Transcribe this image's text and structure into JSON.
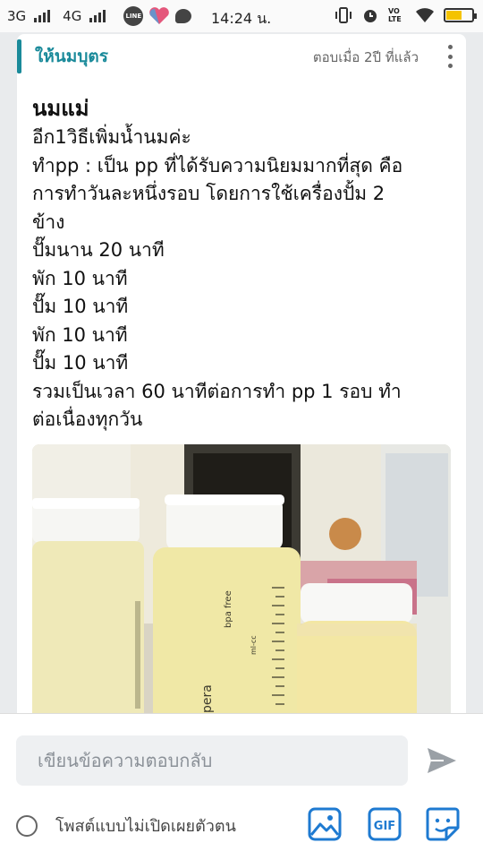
{
  "status_bar": {
    "network1": "3G",
    "network2": "4G",
    "line_label": "LINE",
    "time": "14:24 น.",
    "lte_label": "VO LTE"
  },
  "post": {
    "category": "ให้นมบุตร",
    "reply_time": "ตอบเมื่อ 2ปี ที่แล้ว",
    "title": "นมแม่",
    "body_lines": [
      "อีก1วิธีเพิ่มน้ำนมค่ะ",
      "ทำpp : เป็น pp ที่ได้รับความนิยมมากที่สุด คือ",
      "การทำวันละหนึ่งรอบ โดยการใช้เครื่องปั้ม 2",
      "ข้าง",
      "ปั๊มนาน 20 นาที",
      "พัก 10 นาที",
      "ปั๊ม 10 นาที",
      "พัก 10 นาที",
      "ปั๊ม 10 นาที",
      "รวมเป็นเวลา 60 นาทีต่อการทำ pp 1 รอบ ทำ",
      "ต่อเนื่องทุกวัน"
    ],
    "photo": {
      "bottle_text_1": "pera",
      "bottle_text_2": "bpa free",
      "bottle_text_3": "ml-cc"
    }
  },
  "reply_bar": {
    "placeholder": "เขียนข้อความตอบกลับ",
    "anonymous_label": "โพสต์แบบไม่เปิดเผยตัวตน",
    "gif_label": "GIF"
  },
  "colors": {
    "accent": "#1a8a9a",
    "tool_blue": "#1e7ad1"
  }
}
